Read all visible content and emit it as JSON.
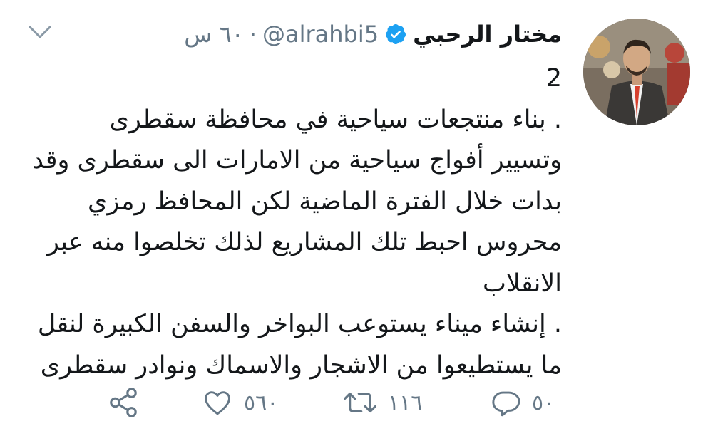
{
  "tweet": {
    "author_name": "مختار الرحبي",
    "handle": "@alrahbi5",
    "separator": "·",
    "time": "٦٠ س",
    "verified": true,
    "lines": [
      "2",
      ". بناء منتجعات سياحية في محافظة سقطرى",
      "وتسيير أفواج سياحية من الامارات الى سقطرى وقد",
      "بدات خلال الفترة الماضية لكن المحافظ رمزي",
      "محروس احبط تلك المشاريع لذلك تخلصوا منه عبر",
      "الانقلاب",
      ". إنشاء ميناء يستوعب البواخر والسفن الكبيرة لنقل",
      "ما يستطيعوا من الاشجار والاسماك ونوادر سقطرى"
    ]
  },
  "actions": {
    "reply": {
      "icon": "reply-icon",
      "count": "٥٠"
    },
    "retweet": {
      "icon": "retweet-icon",
      "count": "١١٦"
    },
    "like": {
      "icon": "heart-icon",
      "count": "٥٦٠"
    },
    "share": {
      "icon": "share-icon"
    }
  },
  "colors": {
    "text": "#14171a",
    "secondary": "#657786",
    "verified": "#1da1f2",
    "background": "#ffffff"
  }
}
